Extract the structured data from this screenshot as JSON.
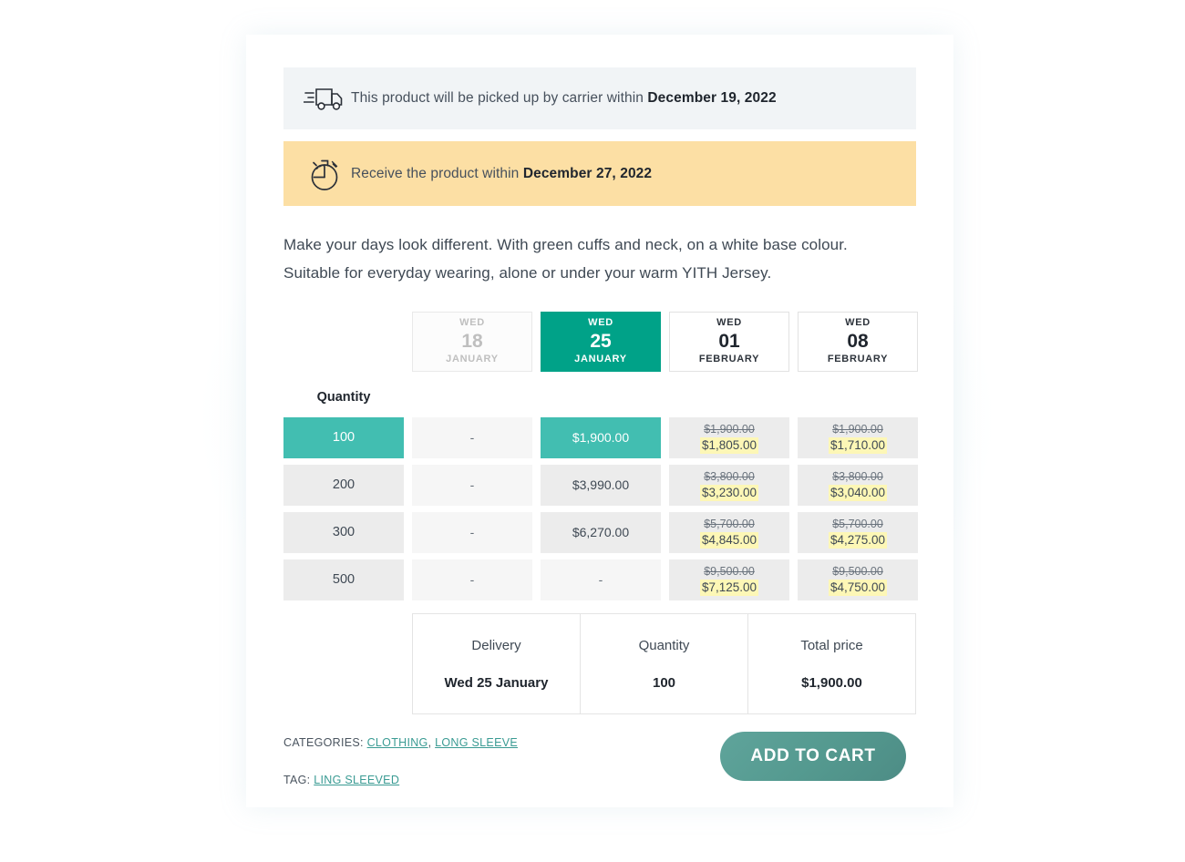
{
  "notices": {
    "shipping": {
      "icon": "truck-icon",
      "text_before": "This product will be picked up by carrier within ",
      "date": "December 19, 2022",
      "bg": "#f1f4f6"
    },
    "receive": {
      "icon": "stopwatch-icon",
      "text_before": "Receive the product within ",
      "date": "December 27, 2022",
      "bg": "#fcdfa4"
    }
  },
  "description": {
    "line1": "Make your days look different. With green cuffs and neck, on a white base colour.",
    "line2": "Suitable for everyday wearing, alone or under your warm YITH Jersey."
  },
  "matrix": {
    "quantity_label": "Quantity",
    "dates": [
      {
        "dow": "WED",
        "day": "18",
        "month": "JANUARY",
        "state": "disabled"
      },
      {
        "dow": "WED",
        "day": "25",
        "month": "JANUARY",
        "state": "selected"
      },
      {
        "dow": "WED",
        "day": "01",
        "month": "FEBRUARY",
        "state": "default"
      },
      {
        "dow": "WED",
        "day": "08",
        "month": "FEBRUARY",
        "state": "default"
      }
    ],
    "rows": [
      {
        "qty": "100",
        "qty_state": "sel",
        "cells": [
          {
            "value": "-",
            "state": "muted"
          },
          {
            "value": "$1,900.00",
            "state": "sel"
          },
          {
            "old": "$1,900.00",
            "new": "$1,805.00",
            "state": "normal"
          },
          {
            "old": "$1,900.00",
            "new": "$1,710.00",
            "state": "normal"
          }
        ]
      },
      {
        "qty": "200",
        "qty_state": "normal",
        "cells": [
          {
            "value": "-",
            "state": "muted"
          },
          {
            "value": "$3,990.00",
            "state": "normal"
          },
          {
            "old": "$3,800.00",
            "new": "$3,230.00",
            "state": "normal"
          },
          {
            "old": "$3,800.00",
            "new": "$3,040.00",
            "state": "normal"
          }
        ]
      },
      {
        "qty": "300",
        "qty_state": "normal",
        "cells": [
          {
            "value": "-",
            "state": "muted"
          },
          {
            "value": "$6,270.00",
            "state": "normal"
          },
          {
            "old": "$5,700.00",
            "new": "$4,845.00",
            "state": "normal"
          },
          {
            "old": "$5,700.00",
            "new": "$4,275.00",
            "state": "normal"
          }
        ]
      },
      {
        "qty": "500",
        "qty_state": "normal",
        "cells": [
          {
            "value": "-",
            "state": "muted"
          },
          {
            "value": "-",
            "state": "muted"
          },
          {
            "old": "$9,500.00",
            "new": "$7,125.00",
            "state": "normal"
          },
          {
            "old": "$9,500.00",
            "new": "$4,750.00",
            "state": "normal"
          }
        ]
      }
    ]
  },
  "summary": {
    "columns": [
      {
        "label": "Delivery",
        "value": "Wed 25 January"
      },
      {
        "label": "Quantity",
        "value": "100"
      },
      {
        "label": "Total price",
        "value": "$1,900.00"
      }
    ]
  },
  "footer": {
    "categories_label": "CATEGORIES:",
    "categories": [
      "CLOTHING",
      "LONG SLEEVE"
    ],
    "tag_label": "TAG:",
    "tags": [
      "LING SLEEVED"
    ],
    "add_to_cart_label": "ADD TO CART"
  },
  "colors": {
    "accent_teal": "#00a288",
    "selected_cell_teal": "#42beb1",
    "button_teal": "#54998f",
    "highlight_yellow": "#fdf7b6",
    "notice_orange": "#fcdfa4",
    "notice_grey": "#f1f4f6",
    "link_teal": "#3a9b93"
  }
}
